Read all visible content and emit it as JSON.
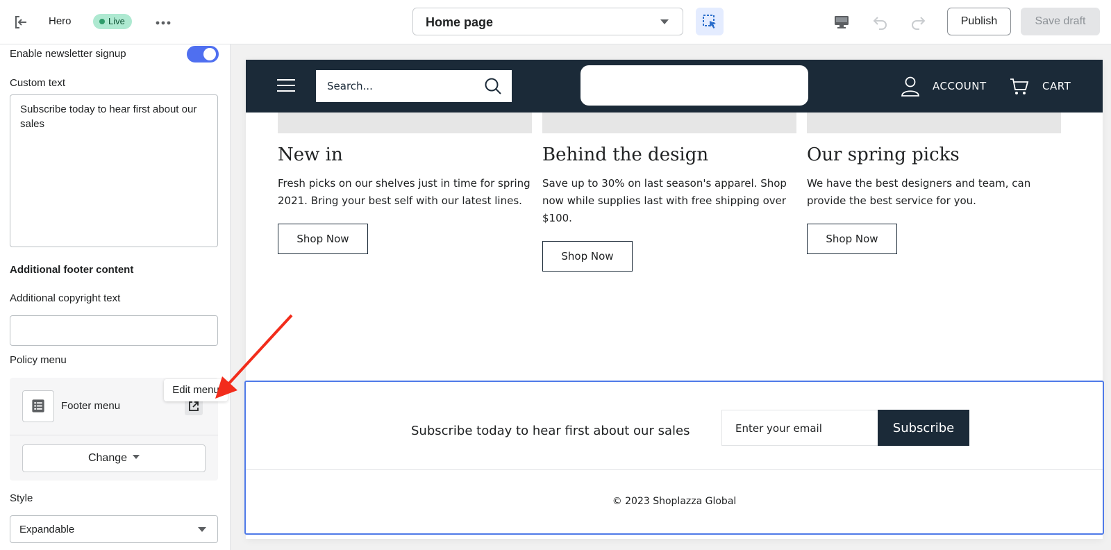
{
  "topbar": {
    "section_title": "Hero",
    "status_badge": "Live",
    "page_select": "Home page",
    "publish_label": "Publish",
    "save_draft_label": "Save draft"
  },
  "panel": {
    "newsletter_toggle_label": "Enable newsletter signup",
    "newsletter_enabled": true,
    "custom_text_label": "Custom text",
    "custom_text_value": "Subscribe today to hear first about our sales",
    "additional_footer_heading": "Additional footer content",
    "copyright_label": "Additional copyright text",
    "copyright_value": "",
    "policy_menu_label": "Policy menu",
    "policy_menu_name": "Footer menu",
    "edit_menu_tooltip": "Edit menu",
    "change_label": "Change",
    "style_label": "Style",
    "style_value": "Expandable"
  },
  "preview": {
    "search_placeholder": "Search...",
    "account_label": "ACCOUNT",
    "cart_label": "CART",
    "cards": [
      {
        "title": "New in",
        "text": "Fresh picks on our shelves just in time for spring 2021. Bring your best self with our latest lines.",
        "button": "Shop Now"
      },
      {
        "title": "Behind the design",
        "text": "Save up to 30% on last season's apparel. Shop now while supplies last with free shipping over $100.",
        "button": "Shop Now"
      },
      {
        "title": "Our spring picks",
        "text": "We have the best designers and team, can provide the best service for you.",
        "button": "Shop Now"
      }
    ],
    "newsletter_text": "Subscribe today to hear first about our sales",
    "email_placeholder": "Enter your email",
    "subscribe_label": "Subscribe",
    "copyright": "© 2023 Shoplazza Global"
  },
  "colors": {
    "accent": "#4f6ff0",
    "store_dark": "#1b2a38",
    "annotation_arrow": "#f22c1b"
  }
}
